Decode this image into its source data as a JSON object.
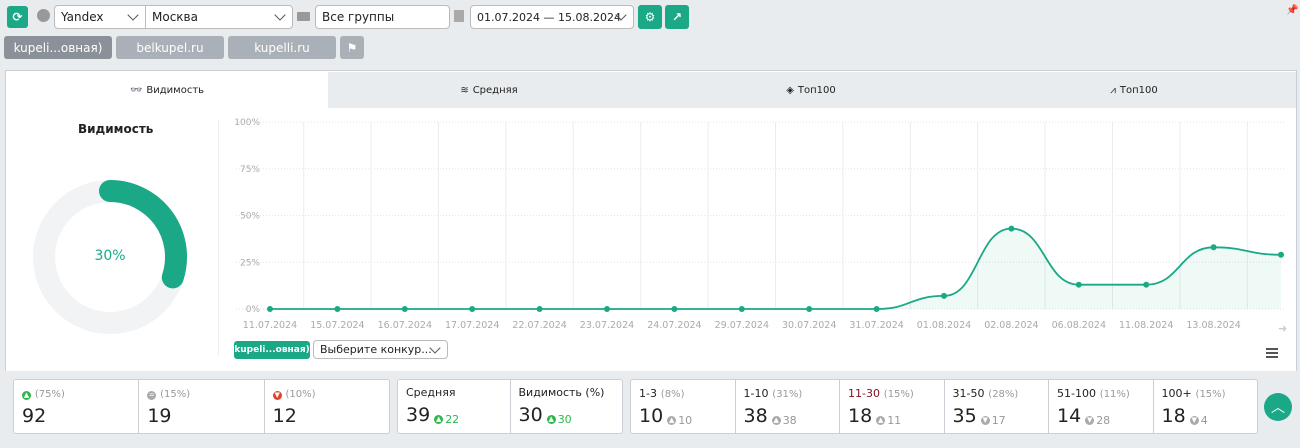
{
  "toolbar": {
    "engine": "Yandex",
    "region": "Москва",
    "group": "Все группы",
    "date_range": "01.07.2024 — 15.08.2024"
  },
  "projects": [
    "kupeli...овная)",
    "belkupel.ru",
    "kupelli.ru"
  ],
  "tabs": [
    {
      "label": "Видимость"
    },
    {
      "label": "Средняя"
    },
    {
      "label": "Топ100"
    },
    {
      "label": "Топ100"
    }
  ],
  "donut": {
    "title": "Видимость",
    "value": 30,
    "label": "30%",
    "color": "#1aa886"
  },
  "legend": {
    "site": "kupeli...овная)",
    "competitor_placeholder": "Выберите конкур..."
  },
  "chart_data": {
    "type": "area",
    "categories": [
      "11.07.2024",
      "15.07.2024",
      "16.07.2024",
      "17.07.2024",
      "22.07.2024",
      "23.07.2024",
      "24.07.2024",
      "29.07.2024",
      "30.07.2024",
      "31.07.2024",
      "01.08.2024",
      "02.08.2024",
      "06.08.2024",
      "11.08.2024",
      "13.08.2024",
      ""
    ],
    "values": [
      0,
      0,
      0,
      0,
      0,
      0,
      0,
      0,
      0,
      0,
      7,
      43,
      13,
      13,
      33,
      29
    ],
    "yticks": [
      "0%",
      "25%",
      "50%",
      "75%",
      "100%"
    ],
    "ylim": [
      0,
      100
    ],
    "grid": true,
    "color": "#1aa886"
  },
  "stats": {
    "trend": [
      {
        "pct": "(75%)",
        "value": "92",
        "icon": "up",
        "color": "#2db84d"
      },
      {
        "pct": "(15%)",
        "value": "19",
        "icon": "equal",
        "color": "#aaa"
      },
      {
        "pct": "(10%)",
        "value": "12",
        "icon": "down",
        "color": "#e2412f"
      }
    ],
    "avg": [
      {
        "label": "Средняя",
        "value": "39",
        "delta": "22"
      },
      {
        "label": "Видимость (%)",
        "value": "30",
        "delta": "30"
      }
    ],
    "ranges": [
      {
        "label": "1-3",
        "pct": "(8%)",
        "value": "10",
        "delta": "10",
        "dir": "up"
      },
      {
        "label": "1-10",
        "pct": "(31%)",
        "value": "38",
        "delta": "38",
        "dir": "up"
      },
      {
        "label": "11-30",
        "pct": "(15%)",
        "value": "18",
        "delta": "11",
        "dir": "up"
      },
      {
        "label": "31-50",
        "pct": "(28%)",
        "value": "35",
        "delta": "17",
        "dir": "down"
      },
      {
        "label": "51-100",
        "pct": "(11%)",
        "value": "14",
        "delta": "28",
        "dir": "down"
      },
      {
        "label": "100+",
        "pct": "(15%)",
        "value": "18",
        "delta": "4",
        "dir": "down"
      }
    ]
  }
}
